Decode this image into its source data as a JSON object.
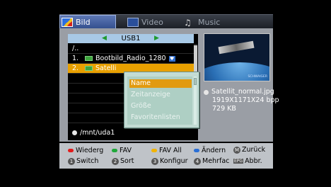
{
  "tabs": [
    {
      "label": "Bild",
      "icon": "picture-icon",
      "active": true
    },
    {
      "label": "Video",
      "icon": "video-icon",
      "active": false
    },
    {
      "label": "Music",
      "icon": "music-note-icon",
      "active": false
    }
  ],
  "list": {
    "header": "USB1",
    "rows": [
      {
        "num": "/..",
        "name": ""
      },
      {
        "num": "1.",
        "name": "Bootbild_Radio_1280",
        "favorite": true
      },
      {
        "num": "2.",
        "name": "Satelli",
        "selected": true
      }
    ],
    "path": "/mnt/uda1"
  },
  "preview": {
    "brand": "SCHWAIGER",
    "filename": "Satellit_normal.jpg",
    "dimensions": "1919X1171X24 bpp",
    "size": "729 KB"
  },
  "popup": {
    "items": [
      {
        "label": "Name",
        "active": true
      },
      {
        "label": "Zeitanzeige",
        "active": false
      },
      {
        "label": "Größe",
        "active": false
      },
      {
        "label": "Favoritenlisten",
        "active": false
      }
    ]
  },
  "footer": {
    "red_label": "Wiederg",
    "green_label": "FAV",
    "yellow_label": "FAV All",
    "blue_label": "Ändern",
    "menu_key": "M",
    "menu_label": "Zurück",
    "k1": "1",
    "k1_label": "Switch",
    "k2": "2",
    "k2_label": "Sort",
    "k3": "3",
    "k3_label": "Konfigur",
    "k4": "4",
    "k4_label": "Mehrfac",
    "epg_key": "EPG",
    "epg_label": "Abbr."
  },
  "colors": {
    "red": "#e21b1b",
    "green": "#1fa83a",
    "yellow": "#f2b400",
    "blue": "#2a6fd6",
    "highlight": "#e8a000"
  }
}
